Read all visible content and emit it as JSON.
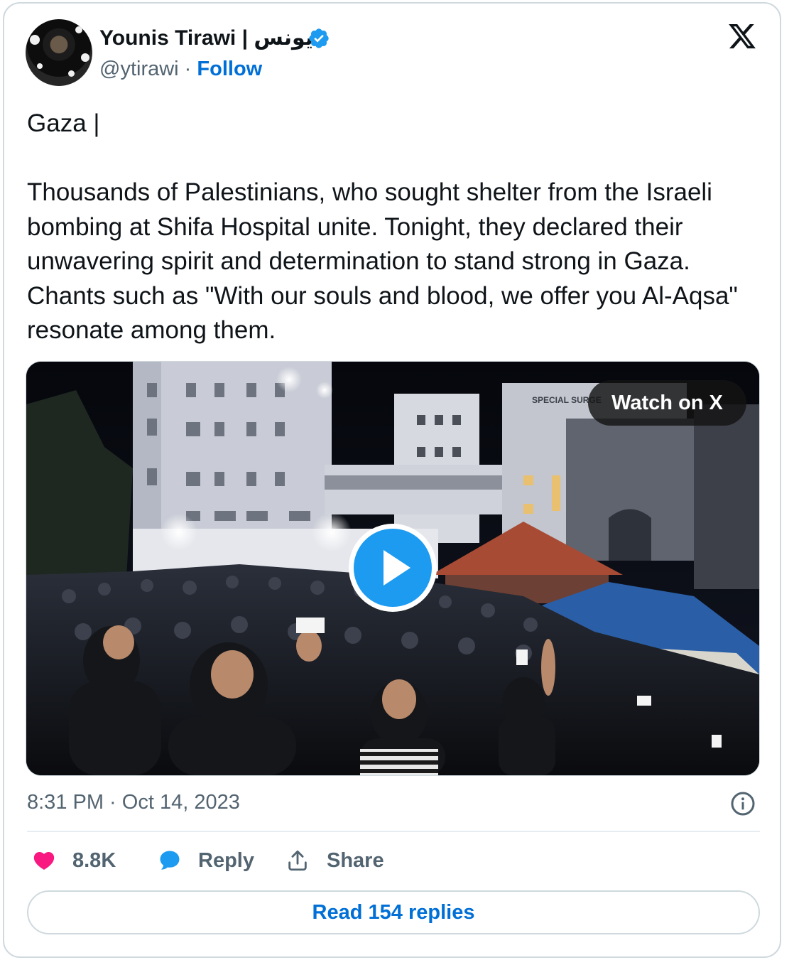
{
  "author": {
    "display_name": "Younis Tirawi | يونس",
    "handle": "@ytirawi",
    "separator": " · ",
    "follow_label": "Follow",
    "verified": true
  },
  "tweet": {
    "text": "Gaza |\n\nThousands of Palestinians, who sought shelter from the Israeli bombing at Shifa Hospital unite. Tonight, they declared their unwavering spirit and determination to stand strong in Gaza. Chants such as \"With our souls and blood, we offer you Al-Aqsa\" resonate among them.",
    "timestamp": "8:31 PM · Oct 14, 2023"
  },
  "media": {
    "watch_label": "Watch on X",
    "sign_text": "SPECIAL SURGE"
  },
  "actions": {
    "likes": "8.8K",
    "reply_label": "Reply",
    "share_label": "Share",
    "read_replies_label": "Read 154 replies"
  },
  "colors": {
    "accent": "#006fd6",
    "like": "#f91880",
    "reply": "#1d9bf0",
    "verified": "#1d9bf0",
    "text_secondary": "#536471",
    "border": "#cfd9de"
  },
  "icons": {
    "brand": "x-logo",
    "verified": "verified-badge-icon",
    "like": "heart-icon",
    "reply": "speech-bubble-icon",
    "share": "share-upload-icon",
    "info": "info-icon",
    "play": "play-icon"
  }
}
